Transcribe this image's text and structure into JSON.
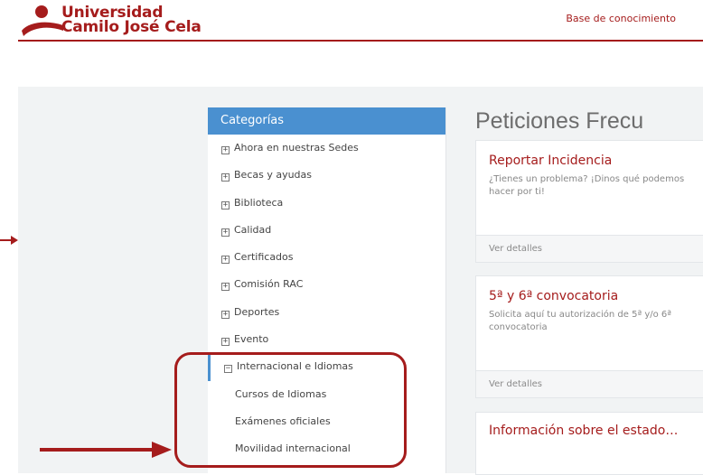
{
  "brand": {
    "line1": "Universidad",
    "line2": "Camilo José Cela",
    "color": "#a51c1c"
  },
  "header": {
    "link": "Base de conocimiento"
  },
  "sidebar": {
    "title": "Categorías",
    "accent": "#4a90d0",
    "items": [
      {
        "label": "Ahora en nuestras Sedes",
        "icon": "plus-box-icon"
      },
      {
        "label": "Becas y ayudas",
        "icon": "plus-box-icon"
      },
      {
        "label": "Biblioteca",
        "icon": "plus-box-icon"
      },
      {
        "label": "Calidad",
        "icon": "plus-box-icon"
      },
      {
        "label": "Certificados",
        "icon": "plus-box-icon"
      },
      {
        "label": "Comisión RAC",
        "icon": "plus-box-icon"
      },
      {
        "label": "Deportes",
        "icon": "plus-box-icon"
      },
      {
        "label": "Evento",
        "icon": "plus-box-icon"
      },
      {
        "label": "Internacional e Idiomas",
        "icon": "minus-box-icon",
        "expanded": true
      }
    ],
    "subitems": [
      {
        "label": "Cursos de Idiomas"
      },
      {
        "label": "Exámenes oficiales"
      },
      {
        "label": "Movilidad internacional"
      }
    ]
  },
  "main": {
    "title": "Peticiones Frecu",
    "cards": [
      {
        "title": "Reportar Incidencia",
        "desc": "¿Tienes un problema? ¡Dinos qué podemos hacer por ti!",
        "footer": "Ver detalles"
      },
      {
        "title": "5ª y 6ª convocatoria",
        "desc": "Solicita aquí tu autorización de 5ª y/o 6ª convocatoria",
        "footer": "Ver detalles"
      },
      {
        "title": "Información sobre el estado…"
      }
    ]
  },
  "annotations": {
    "color": "#a51c1c"
  }
}
